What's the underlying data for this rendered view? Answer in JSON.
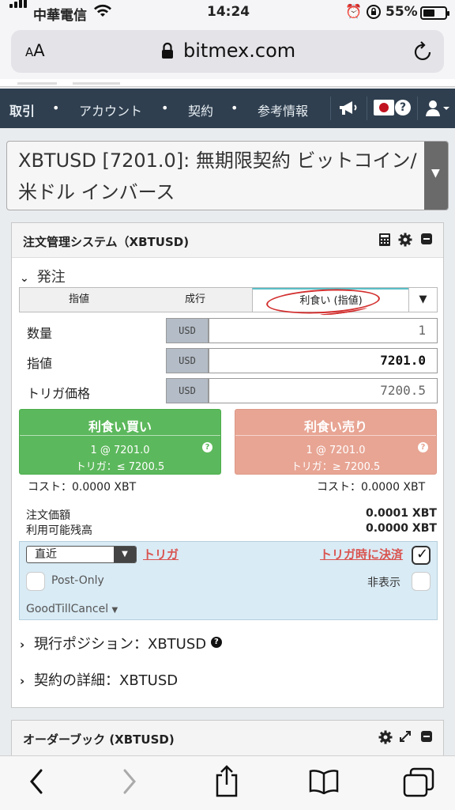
{
  "status_bar": {
    "carrier": "中華電信",
    "time": "14:24",
    "battery": "55%",
    "battery_level": 0.55
  },
  "browser": {
    "aa_label": "AA",
    "domain": "bitmex.com"
  },
  "navbar": {
    "brand": "取引",
    "items": [
      "アカウント",
      "契約",
      "参考情報"
    ],
    "help": "?"
  },
  "contract": {
    "text": "XBTUSD [7201.0]: 無期限契約 ビットコイン/米ドル インバース"
  },
  "order_panel": {
    "title": "注文管理システム（XBTUSD)",
    "section": "発注",
    "tabs": [
      "指値",
      "成行",
      "利食い (指値)"
    ],
    "active_tab": "利食い (指値)",
    "fields": [
      {
        "label": "数量",
        "unit": "USD",
        "value": "1"
      },
      {
        "label": "指値",
        "unit": "USD",
        "value": "7201.0"
      },
      {
        "label": "トリガ価格",
        "unit": "USD",
        "value": "7200.5"
      }
    ],
    "buy": {
      "title": "利食い買い",
      "line1": "1 @ 7201.0",
      "line2": "トリガ：≤ 7200.5",
      "cost": "コスト：0.0000 XBT"
    },
    "sell": {
      "title": "利食い売り",
      "line1": "1 @ 7201.0",
      "line2": "トリガ：≥ 7200.5",
      "cost": "コスト：0.0000 XBT"
    },
    "order_value_label": "注文価額",
    "order_value": "0.0001 XBT",
    "available_label": "利用可能残高",
    "available": "0.0000 XBT",
    "trigger_select": "直近",
    "trigger_link": "トリガ",
    "close_on_trigger": "トリガ時に決済",
    "close_on_trigger_checked": true,
    "post_only": "Post-Only",
    "hidden": "非表示",
    "tif": "GoodTillCancel",
    "position_section": "現行ポジション：XBTUSD",
    "contract_section": "契約の詳細：XBTUSD"
  },
  "orderbook_panel": {
    "title": "オーダーブック (XBTUSD)"
  },
  "icons": [
    "calculator-icon",
    "gear-icon",
    "minimize-icon",
    "megaphone-icon",
    "user-icon",
    "expand-icon"
  ]
}
